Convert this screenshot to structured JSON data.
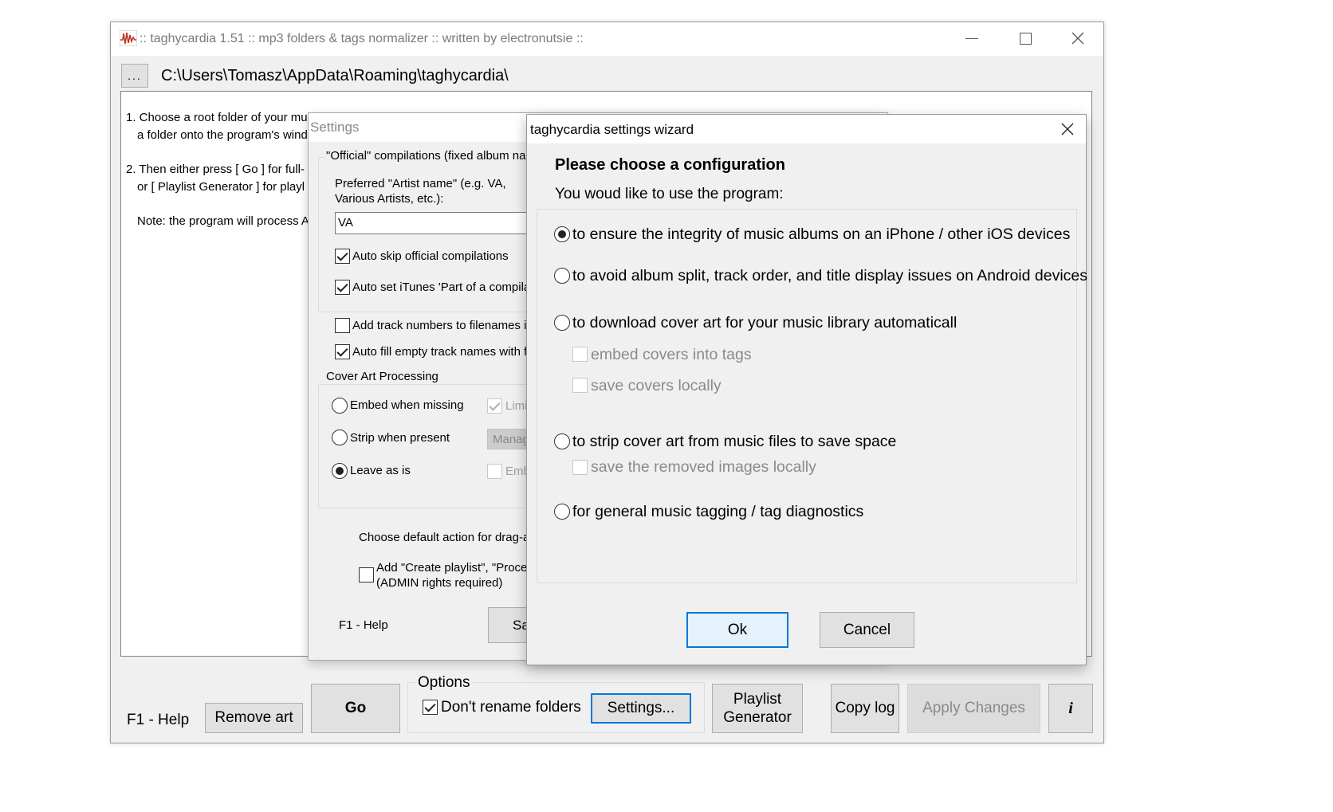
{
  "main": {
    "title": ":: taghycardia 1.51 :: mp3 folders & tags normalizer :: written by electronutsie ::",
    "browse_label": "...",
    "path": "C:\\Users\\Tomasz\\AppData\\Roaming\\taghycardia\\",
    "instructions": [
      "1. Choose a root folder of your mu",
      "a folder onto the program's wind",
      "2. Then either press [ Go ] for full-",
      "or [ Playlist Generator ] for playl",
      "Note: the program will process A"
    ],
    "help": "F1 - Help",
    "remove_art": "Remove art",
    "go": "Go",
    "options_title": "Options",
    "dont_rename": "Don't rename folders",
    "settings": "Settings...",
    "playlist_line1": "Playlist",
    "playlist_line2": "Generator",
    "copy_log": "Copy log",
    "apply": "Apply Changes",
    "info": "i"
  },
  "settings": {
    "title": "Settings",
    "group_official": "\"Official\" compilations (fixed album nam",
    "artist_label_1": "Preferred \"Artist name\" (e.g. VA,",
    "artist_label_2": "Various Artists, etc.):",
    "artist_value": "VA",
    "auto_skip": "Auto skip official compilations",
    "auto_set": "Auto set iTunes 'Part of a compila",
    "add_track": "Add track numbers to filenames if",
    "auto_fill": "Auto fill empty track names with fi",
    "cover_group": "Cover Art Processing",
    "embed_missing": "Embed when missing",
    "strip_present": "Strip when present",
    "leave": "Leave as is",
    "limit": "Limi",
    "manage": "Manag",
    "emb": "Emb",
    "drag_action": "Choose default action for drag-a",
    "add_create_1": "Add \"Create playlist\", \"Proces",
    "add_create_2": "(ADMIN rights required)",
    "help": "F1 - Help",
    "save": "Sa"
  },
  "wizard": {
    "title": "taghycardia settings wizard",
    "heading": "Please choose a configuration",
    "subheading": "You woud like to use the program:",
    "opt_ios": "to ensure the integrity of music albums on an iPhone / other iOS devices",
    "opt_android": "to avoid album split, track order, and title display issues on Android devices",
    "opt_cover": "to download cover art for your music library automaticall",
    "embed_covers": "embed covers into tags",
    "save_covers": "save covers locally",
    "opt_strip": "to strip cover art from music files to save space",
    "save_removed": "save the removed images locally",
    "opt_general": "for general music tagging / tag diagnostics",
    "ok": "Ok",
    "cancel": "Cancel"
  }
}
